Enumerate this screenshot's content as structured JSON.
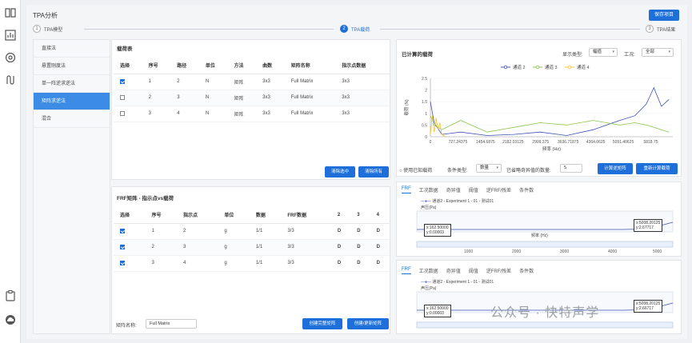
{
  "app": {
    "title": "TPA分析",
    "save_label": "保存项目"
  },
  "steps": [
    {
      "num": "1",
      "label": "TPA模型"
    },
    {
      "num": "2",
      "label": "TPA载荷"
    },
    {
      "num": "3",
      "label": "TPA结果"
    }
  ],
  "methods": [
    "直接法",
    "悬置刚度法",
    "单一阵逆求逆法",
    "矩阵求逆法",
    "混合"
  ],
  "load_table": {
    "title": "载荷表",
    "headers": [
      "选择",
      "序号",
      "路径",
      "单位",
      "方法",
      "曲数",
      "矩阵名称",
      "指示点数据"
    ],
    "rows": [
      {
        "checked": true,
        "cells": [
          "1",
          "2",
          "N",
          "矩阵",
          "3x3",
          "Full Matrix",
          "3x3"
        ]
      },
      {
        "checked": false,
        "cells": [
          "2",
          "3",
          "N",
          "矩阵",
          "3x3",
          "Full Matrix",
          "3x3"
        ]
      },
      {
        "checked": false,
        "cells": [
          "3",
          "4",
          "N",
          "矩阵",
          "3x3",
          "Full Matrix",
          "3x3"
        ]
      }
    ],
    "clear_selected": "清除选中",
    "clear_all": "清除所有"
  },
  "frf_table": {
    "title": "FRF矩阵 - 指示点vs载荷",
    "headers": [
      "选择",
      "序号",
      "指示点",
      "单位",
      "数据",
      "FRF数据",
      "2",
      "3",
      "4"
    ],
    "rows": [
      {
        "checked": true,
        "cells": [
          "1",
          "2",
          "g",
          "1/1",
          "3/3",
          "D",
          "D",
          "D"
        ]
      },
      {
        "checked": true,
        "cells": [
          "2",
          "3",
          "g",
          "1/1",
          "3/3",
          "D",
          "D",
          "D"
        ]
      },
      {
        "checked": true,
        "cells": [
          "3",
          "4",
          "g",
          "1/1",
          "3/3",
          "D",
          "D",
          "D"
        ]
      }
    ],
    "matrix_name_label": "矩阵名称:",
    "matrix_name_value": "Full Matrix",
    "create_full": "创建完整矩阵",
    "create_update": "创建/更新矩阵"
  },
  "calc_panel": {
    "title": "已计算的载荷",
    "display_type_label": "显示类型:",
    "display_type_value": "幅值",
    "condition_label": "工况:",
    "condition_value": "全部",
    "use_known_load": "使用已知载荷",
    "condition_type_label": "条件类型:",
    "condition_type_value": "数量",
    "singular_label": "已省略奇异值的数量:",
    "singular_value": "5",
    "calc_inverse": "计算逆矩阵",
    "recalc_load": "重新计算载荷"
  },
  "chart_data": {
    "type": "line",
    "title": "",
    "xlabel": "频率 (Hz)",
    "ylabel": "载荷 (N)",
    "x_ticks": [
      "0",
      "727.24375",
      "1454.6875",
      "2182.03125",
      "2909.375",
      "3636.71875",
      "4364.0625",
      "5091.40625",
      "5818.75"
    ],
    "y_ticks": [
      "0",
      "0.5",
      "1",
      "1.5",
      "2",
      "2.5"
    ],
    "xlim": [
      0,
      6400
    ],
    "ylim": [
      0,
      2.5
    ],
    "series": [
      {
        "name": "通道 2",
        "color": "#3f51b5",
        "x": [
          0,
          100,
          300,
          800,
          1500,
          2200,
          2900,
          3600,
          4300,
          5000,
          5400,
          5700,
          5900,
          6100,
          6300
        ],
        "y": [
          1.5,
          0.6,
          0.1,
          0.2,
          0.05,
          0.1,
          0.2,
          0.05,
          0.3,
          0.7,
          0.9,
          1.4,
          2.1,
          1.3,
          1.6
        ]
      },
      {
        "name": "通道 3",
        "color": "#8bc34a",
        "x": [
          0,
          100,
          300,
          800,
          1500,
          2200,
          2900,
          3600,
          4300,
          5000,
          5400,
          5700,
          5900,
          6100,
          6300
        ],
        "y": [
          0.9,
          0.5,
          0.3,
          0.7,
          0.2,
          0.4,
          0.6,
          0.5,
          0.7,
          0.5,
          0.6,
          0.5,
          0.4,
          0.3,
          0.2
        ]
      },
      {
        "name": "通道 4",
        "color": "#f1c232",
        "x": [
          0,
          50,
          100,
          150,
          200,
          250,
          300,
          400
        ],
        "y": [
          0.1,
          0.9,
          0.2,
          0.8,
          0.3,
          0.6,
          0.1,
          0.0
        ]
      }
    ]
  },
  "frf_view_1": {
    "tabs": [
      "FRF",
      "工况数据",
      "奇异值",
      "阈值",
      "逆FRF/残差",
      "条件数"
    ],
    "legend": "通道2 - Experiment 1 - 01 - 测试01",
    "ylabel": "声压(Pa)",
    "xlabel": "频率 (Hz)",
    "x_ticks": [
      "1000",
      "2000",
      "3000",
      "4000",
      "5000"
    ],
    "tip_left": [
      "x:162.50000",
      "y:0.00003"
    ],
    "tip_right": [
      "x:5008.20125",
      "y:2.67717"
    ]
  },
  "frf_view_2": {
    "tabs": [
      "FRF",
      "工况数据",
      "奇异值",
      "阈值",
      "逆FRF/残差",
      "条件数"
    ],
    "legend": "通道2 - Experiment 1 - 01 - 测试01",
    "ylabel": "声压(Pa)",
    "tip_left": [
      "x:162.50000",
      "y:0.00003"
    ],
    "tip_right": [
      "x:5008.20125",
      "y:2.66717"
    ]
  },
  "watermark": "公众号 · 快特声学"
}
